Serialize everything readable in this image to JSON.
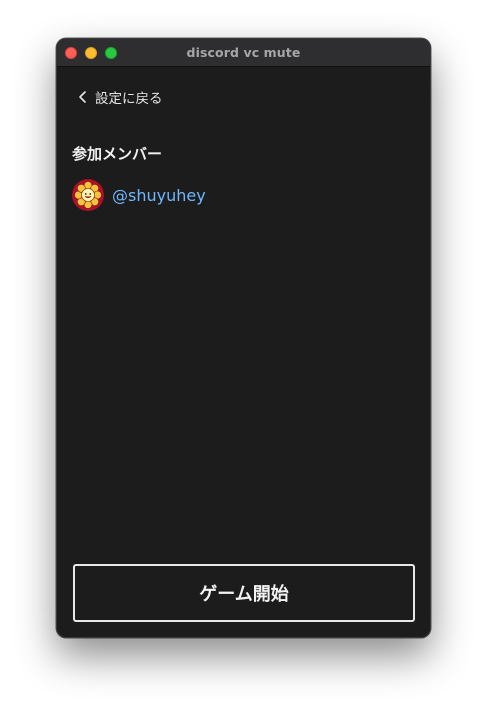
{
  "window": {
    "title": "discord vc mute"
  },
  "nav": {
    "back_label": "設定に戻る"
  },
  "members": {
    "heading": "参加メンバー",
    "list": [
      {
        "name": "@shuyuhey"
      }
    ]
  },
  "actions": {
    "start_label": "ゲーム開始"
  },
  "colors": {
    "background": "#1c1c1c",
    "titlebar": "#2e2d30",
    "member_name": "#6fb7ff",
    "button_border": "#e8e8e8"
  },
  "icons": {
    "back": "chevron-left-icon",
    "avatar": "flower-avatar"
  }
}
